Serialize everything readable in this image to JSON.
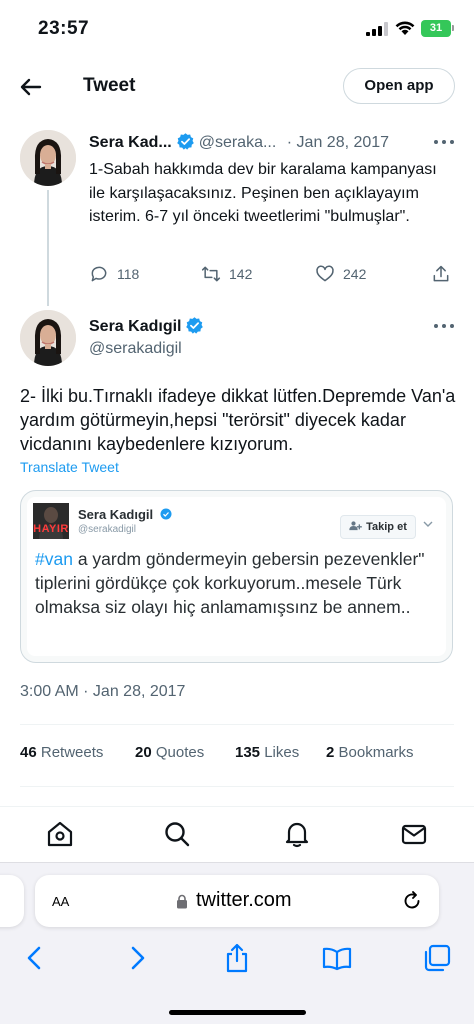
{
  "status_bar": {
    "time": "23:57",
    "battery": "31",
    "battery_color": "#34c759"
  },
  "header": {
    "title": "Tweet",
    "open_app_label": "Open app",
    "back_icon": "arrow-left-icon"
  },
  "tweet1": {
    "name": "Sera Kad...",
    "handle": "@seraka...",
    "separator": "·",
    "date": "Jan 28, 2017",
    "text": "1-Sabah hakkımda dev bir karalama kampanyası ile karşılaşacaksınız. Peşinen ben açıklayayım isterim. 6-7 yıl önceki tweetlerimi \"bulmuşlar\".",
    "replies": "118",
    "retweets": "142",
    "likes": "242"
  },
  "tweet2": {
    "name": "Sera Kadıgil",
    "handle": "@serakadigil",
    "text": "2- İlki bu.Tırnaklı ifadeye dikkat lütfen.Depremde Van'a yardım götürmeyin,hepsi \"terörsit\" diyecek kadar vicdanını kaybedenlere kızıyorum.",
    "translate_label": "Translate Tweet",
    "timestamp": "3:00 AM · Jan 28, 2017"
  },
  "embedded_image": {
    "name": "Sera Kadıgil",
    "handle": "@serakadigil",
    "avatar_text": "HAYIR",
    "follow_label": "Takip et",
    "hashtag": "#van",
    "text": " a yardm göndermeyin gebersin pezevenkler\" tiplerini gördükçe çok korkuyorum..mesele Türk olmaksa siz olayı hiç anlamamışsınz be annem.."
  },
  "stats": [
    {
      "count": "46",
      "label": "Retweets"
    },
    {
      "count": "20",
      "label": "Quotes"
    },
    {
      "count": "135",
      "label": "Likes"
    },
    {
      "count": "2",
      "label": "Bookmarks"
    }
  ],
  "tabbar": {
    "icons": [
      "home-icon",
      "search-icon",
      "notifications-icon",
      "messages-icon"
    ]
  },
  "safari": {
    "text_size_label": "AA",
    "url": "twitter.com",
    "toolbar_icons": [
      "back-icon",
      "forward-icon",
      "share-icon",
      "bookmarks-icon",
      "tabs-icon"
    ],
    "accent": "#007aff"
  },
  "colors": {
    "link": "#1d9bf0",
    "verified": "#1d9bf0",
    "text": "#0f1419",
    "muted": "#536471"
  }
}
